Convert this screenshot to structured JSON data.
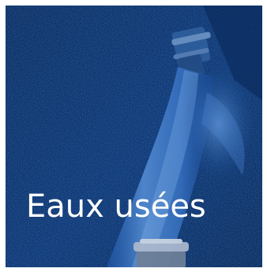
{
  "tile": {
    "title": "Eaux usées",
    "overlay_color": "#0b2f66",
    "text_color": "#ffffff"
  },
  "image": {
    "subject": "water-stream-from-pipe-image"
  }
}
